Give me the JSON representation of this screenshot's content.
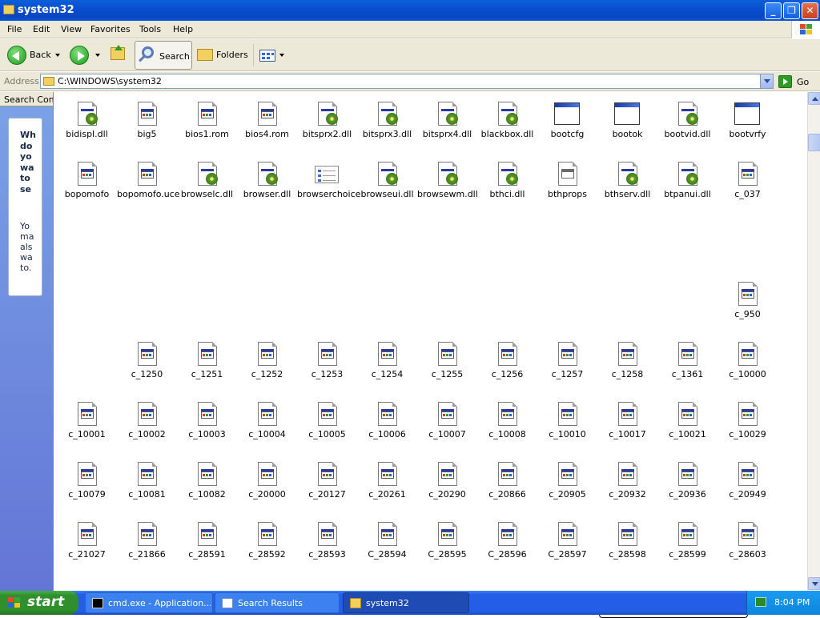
{
  "window": {
    "title": "system32",
    "controls": {
      "minimize": "_",
      "maximize": "❐",
      "close": "✕"
    }
  },
  "menu": [
    "File",
    "Edit",
    "View",
    "Favorites",
    "Tools",
    "Help"
  ],
  "toolbar": {
    "back": "Back",
    "search": "Search",
    "folders": "Folders"
  },
  "address": {
    "label": "Address",
    "path": "C:\\WINDOWS\\system32",
    "go": "Go"
  },
  "left_pane": {
    "tab": "Search Companion",
    "question_lines": [
      "Wh",
      "do",
      "yo",
      "wa",
      "to",
      "se"
    ],
    "note_lines": [
      "Yo",
      "ma",
      "als",
      "wa",
      "to."
    ]
  },
  "files": [
    {
      "name": "bidispl.dll",
      "icon": "dll-icon"
    },
    {
      "name": "big5",
      "icon": "nls-file-icon"
    },
    {
      "name": "bios1.rom",
      "icon": "nls-file-icon"
    },
    {
      "name": "bios4.rom",
      "icon": "nls-file-icon"
    },
    {
      "name": "bitsprx2.dll",
      "icon": "dll-icon"
    },
    {
      "name": "bitsprx3.dll",
      "icon": "dll-icon"
    },
    {
      "name": "bitsprx4.dll",
      "icon": "dll-icon"
    },
    {
      "name": "blackbox.dll",
      "icon": "dll-icon"
    },
    {
      "name": "bootcfg",
      "icon": "application-icon"
    },
    {
      "name": "bootok",
      "icon": "application-icon"
    },
    {
      "name": "bootvid.dll",
      "icon": "dll-icon"
    },
    {
      "name": "bootvrfy",
      "icon": "application-icon"
    },
    {
      "name": "bopomofo",
      "icon": "nls-file-icon"
    },
    {
      "name": "bopomofo.uce",
      "icon": "nls-file-icon"
    },
    {
      "name": "browselc.dll",
      "icon": "dll-icon"
    },
    {
      "name": "browser.dll",
      "icon": "dll-icon"
    },
    {
      "name": "browserchoice",
      "icon": "checklist-app-icon"
    },
    {
      "name": "browseui.dll",
      "icon": "dll-icon"
    },
    {
      "name": "browsewm.dll",
      "icon": "dll-icon"
    },
    {
      "name": "bthci.dll",
      "icon": "dll-icon"
    },
    {
      "name": "bthprops",
      "icon": "control-panel-file-icon"
    },
    {
      "name": "bthserv.dll",
      "icon": "dll-icon"
    },
    {
      "name": "btpanui.dll",
      "icon": "dll-icon"
    },
    {
      "name": "c_037",
      "icon": "nls-file-icon"
    },
    {
      "name": "c_950",
      "icon": "nls-file-icon"
    },
    {
      "name": "c_1250",
      "icon": "nls-file-icon"
    },
    {
      "name": "c_1251",
      "icon": "nls-file-icon"
    },
    {
      "name": "c_1252",
      "icon": "nls-file-icon"
    },
    {
      "name": "c_1253",
      "icon": "nls-file-icon"
    },
    {
      "name": "c_1254",
      "icon": "nls-file-icon"
    },
    {
      "name": "c_1255",
      "icon": "nls-file-icon"
    },
    {
      "name": "c_1256",
      "icon": "nls-file-icon"
    },
    {
      "name": "c_1257",
      "icon": "nls-file-icon"
    },
    {
      "name": "c_1258",
      "icon": "nls-file-icon"
    },
    {
      "name": "c_1361",
      "icon": "nls-file-icon"
    },
    {
      "name": "c_10000",
      "icon": "nls-file-icon"
    },
    {
      "name": "c_10001",
      "icon": "nls-file-icon"
    },
    {
      "name": "c_10002",
      "icon": "nls-file-icon"
    },
    {
      "name": "c_10003",
      "icon": "nls-file-icon"
    },
    {
      "name": "c_10004",
      "icon": "nls-file-icon"
    },
    {
      "name": "c_10005",
      "icon": "nls-file-icon"
    },
    {
      "name": "c_10006",
      "icon": "nls-file-icon"
    },
    {
      "name": "c_10007",
      "icon": "nls-file-icon"
    },
    {
      "name": "c_10008",
      "icon": "nls-file-icon"
    },
    {
      "name": "c_10010",
      "icon": "nls-file-icon"
    },
    {
      "name": "c_10017",
      "icon": "nls-file-icon"
    },
    {
      "name": "c_10021",
      "icon": "nls-file-icon"
    },
    {
      "name": "c_10029",
      "icon": "nls-file-icon"
    },
    {
      "name": "c_10079",
      "icon": "nls-file-icon"
    },
    {
      "name": "c_10081",
      "icon": "nls-file-icon"
    },
    {
      "name": "c_10082",
      "icon": "nls-file-icon"
    },
    {
      "name": "c_20000",
      "icon": "nls-file-icon"
    },
    {
      "name": "c_20127",
      "icon": "nls-file-icon"
    },
    {
      "name": "c_20261",
      "icon": "nls-file-icon"
    },
    {
      "name": "c_20290",
      "icon": "nls-file-icon"
    },
    {
      "name": "c_20866",
      "icon": "nls-file-icon"
    },
    {
      "name": "c_20905",
      "icon": "nls-file-icon"
    },
    {
      "name": "c_20932",
      "icon": "nls-file-icon"
    },
    {
      "name": "c_20936",
      "icon": "nls-file-icon"
    },
    {
      "name": "c_20949",
      "icon": "nls-file-icon"
    },
    {
      "name": "c_21027",
      "icon": "nls-file-icon"
    },
    {
      "name": "c_21866",
      "icon": "nls-file-icon"
    },
    {
      "name": "c_28591",
      "icon": "nls-file-icon"
    },
    {
      "name": "c_28592",
      "icon": "nls-file-icon"
    },
    {
      "name": "c_28593",
      "icon": "nls-file-icon"
    },
    {
      "name": "C_28594",
      "icon": "nls-file-icon"
    },
    {
      "name": "C_28595",
      "icon": "nls-file-icon"
    },
    {
      "name": "C_28596",
      "icon": "nls-file-icon"
    },
    {
      "name": "C_28597",
      "icon": "nls-file-icon"
    },
    {
      "name": "c_28598",
      "icon": "nls-file-icon"
    },
    {
      "name": "c_28599",
      "icon": "nls-file-icon"
    },
    {
      "name": "c_28603",
      "icon": "nls-file-icon"
    }
  ],
  "taskbar": {
    "start": "start",
    "tasks": [
      {
        "label": "cmd.exe - Application...",
        "icon": "cmd-icon"
      },
      {
        "label": "Search Results",
        "icon": "search-results-icon"
      },
      {
        "label": "system32",
        "icon": "folder-icon"
      }
    ],
    "clock": "8:04 PM"
  },
  "colors": {
    "title_bar": "#0a4fd0",
    "taskbar": "#245ee6",
    "start_button": "#2f8f2c",
    "chrome": "#ece9d8"
  }
}
